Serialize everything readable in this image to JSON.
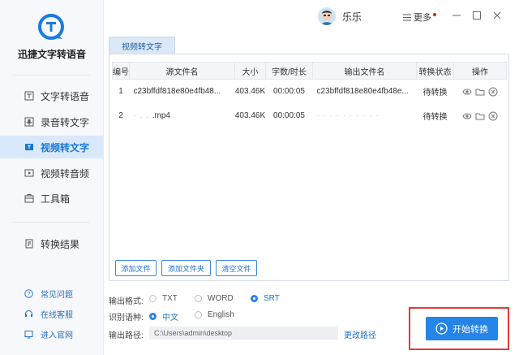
{
  "app": {
    "name": "迅捷文字转语音"
  },
  "sidebar": {
    "items": [
      {
        "label": "文字转语音",
        "icon": "text-to-speech-icon"
      },
      {
        "label": "录音转文字",
        "icon": "record-to-text-icon"
      },
      {
        "label": "视频转文字",
        "icon": "video-to-text-icon",
        "active": true
      },
      {
        "label": "视频转音频",
        "icon": "video-to-audio-icon"
      },
      {
        "label": "工具箱",
        "icon": "toolbox-icon"
      }
    ],
    "result": {
      "label": "转换结果",
      "icon": "result-icon"
    },
    "footer": [
      {
        "label": "常见问题",
        "icon": "help-icon"
      },
      {
        "label": "在线客服",
        "icon": "headset-icon"
      },
      {
        "label": "进入官网",
        "icon": "website-icon"
      }
    ]
  },
  "titlebar": {
    "user_name": "乐乐",
    "more_label": "更多"
  },
  "tab": {
    "label": "视频转文字"
  },
  "table": {
    "headers": [
      "编号",
      "源文件名",
      "大小",
      "字数/时长",
      "输出文件名",
      "转换状态",
      "操作"
    ],
    "rows": [
      {
        "num": "1",
        "source": "c23bffdf818e80e4fb48...",
        "size": "403.46K",
        "duration": "00:00:05",
        "output": "c23bffdf818e80e4fb48e...",
        "status": "待转换"
      },
      {
        "num": "2",
        "source": ".mp4",
        "size": "403.46K",
        "duration": "00:00:05",
        "output": "",
        "status": "待转换"
      }
    ]
  },
  "buttons": {
    "add_file": "添加文件",
    "add_folder": "添加文件夹",
    "clear": "清空文件"
  },
  "options": {
    "format_label": "输出格式:",
    "formats": [
      "TXT",
      "WORD",
      "SRT"
    ],
    "format_selected": "SRT",
    "lang_label": "识别语种:",
    "langs": [
      "中文",
      "English"
    ],
    "lang_selected": "中文",
    "path_label": "输出路径:",
    "path_value": "C:\\Users\\admin\\desktop",
    "change_path": "更改路径"
  },
  "start_button": "开始转换",
  "colors": {
    "accent": "#2584e8",
    "active_bg": "#d9e9fb",
    "highlight": "#e53a3a"
  }
}
